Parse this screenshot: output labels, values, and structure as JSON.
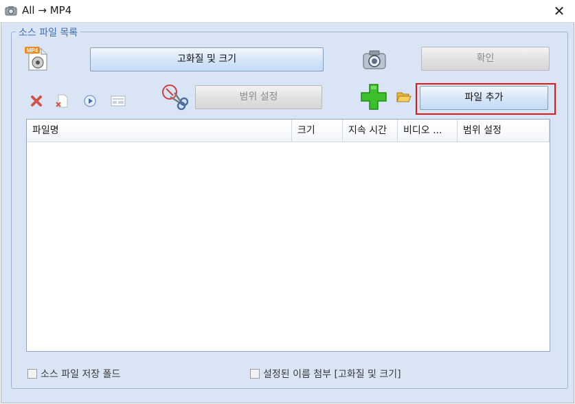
{
  "window": {
    "title": "All → MP4",
    "close_glyph": "✕"
  },
  "group": {
    "label": "소스 파일 목록"
  },
  "toolbar": {
    "quality_size_button": "고화질 및 크기",
    "confirm_button": "확인",
    "range_setting_button": "범위 설정",
    "add_file_button": "파일 추가",
    "mp4_badge": "MP4"
  },
  "list": {
    "columns": [
      "파일명",
      "크기",
      "지속 시간",
      "비디오 ...",
      "범위 설정"
    ],
    "rows": []
  },
  "options": {
    "source_folder_label": "소스 파일 저장 폴드",
    "append_name_label": "설정된 이름 첨부 [고화질 및 크기]"
  },
  "colors": {
    "accent": "#3d6eb3",
    "highlight": "#e01818",
    "panel_bg": "#d9e5f5",
    "add_green": "#3cbf2c"
  }
}
